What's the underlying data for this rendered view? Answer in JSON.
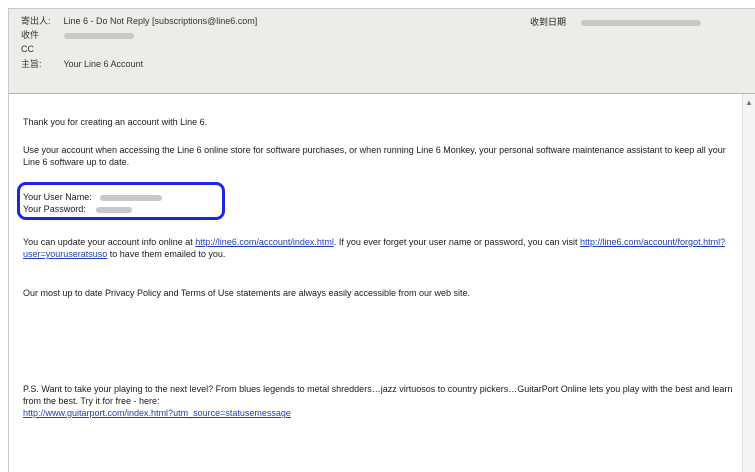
{
  "header": {
    "from_label": "寄出人:",
    "from_value": "Line 6 - Do Not Reply [subscriptions@line6.com]",
    "to_label": "收件",
    "cc_label": "CC",
    "subject_label": "主旨:",
    "subject_value": "Your Line 6 Account",
    "date_label": "收到日期"
  },
  "body": {
    "p1": "Thank you for creating an account with Line 6.",
    "p2": "Use your account when accessing the Line 6 online store for software purchases, or when running Line 6 Monkey, your personal software maintenance assistant to keep all your Line 6 software up to date.",
    "username_label": "Your User Name:",
    "password_label": "Your Password:",
    "p3_a": "You can update your account info online at ",
    "p3_link1": "http://line6.com/account/index.html",
    "p3_b": ". If you ever forget your user name or password, you can visit ",
    "p3_link2": "http://line6.com/account/forgot.html?user=youruseratsuso",
    "p3_c": " to have them emailed to you.",
    "p4": "Our most up to date Privacy Policy and Terms of Use statements are always easily accessible from our web site.",
    "p5": "P.S. Want to take your playing to the next level? From blues legends to metal shredders…jazz virtuosos to country pickers…GuitarPort Online lets you play with the best and learn from the best. Try it for free - here:",
    "p5_link": "http://www.guitarport.com/index.html?utm_source=statusemessage"
  },
  "colors": {
    "highlight": "#1c27e6",
    "link": "#1d3fb8"
  }
}
